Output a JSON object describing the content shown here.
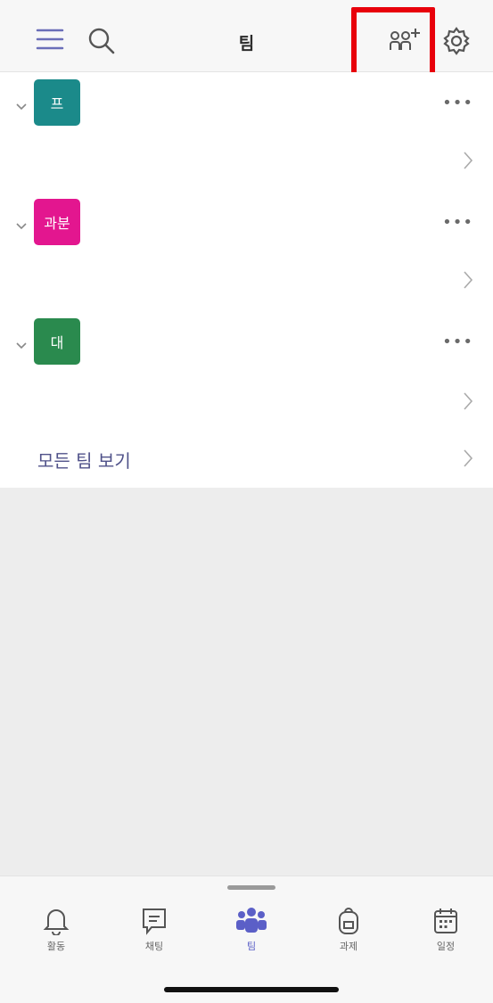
{
  "header": {
    "title": "팀"
  },
  "teams": [
    {
      "avatar_text": "프",
      "avatar_color": "#1b8a8a"
    },
    {
      "avatar_text": "과분",
      "avatar_color": "#e3168f"
    },
    {
      "avatar_text": "대",
      "avatar_color": "#2a8a4e"
    }
  ],
  "more_glyph": "•••",
  "see_all_label": "모든 팀 보기",
  "tabs": [
    {
      "label": "활동",
      "icon": "bell-icon"
    },
    {
      "label": "채팅",
      "icon": "chat-icon"
    },
    {
      "label": "팀",
      "icon": "teams-icon",
      "active": true
    },
    {
      "label": "과제",
      "icon": "backpack-icon"
    },
    {
      "label": "일정",
      "icon": "calendar-icon"
    }
  ],
  "colors": {
    "accent": "#5b5fc7",
    "highlight": "#e8000b"
  }
}
